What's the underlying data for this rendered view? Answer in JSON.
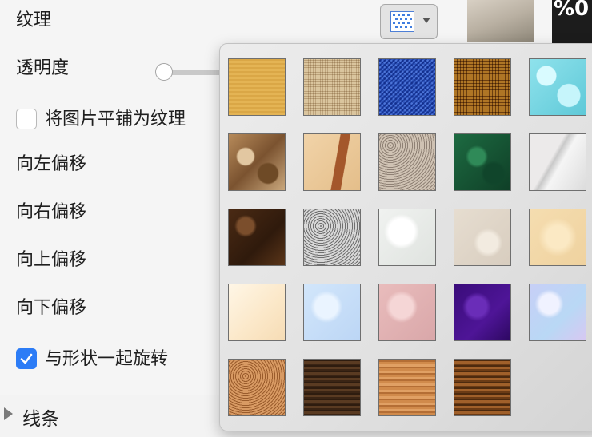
{
  "format_panel": {
    "texture_label": "纹理",
    "transparency_label": "透明度",
    "transparency_value": 0,
    "tile_as_texture": {
      "label": "将图片平铺为纹理",
      "checked": false
    },
    "offset_left_label": "向左偏移",
    "offset_right_label": "向右偏移",
    "offset_up_label": "向上偏移",
    "offset_down_label": "向下偏移",
    "rotate_with_shape": {
      "label": "与形状一起旋转",
      "checked": true
    },
    "line_section_label": "线条"
  },
  "dark_strip_text": "%0",
  "texture_dropdown": {
    "icon": "texture-swatch-icon",
    "textures": [
      {
        "name": "papyrus-texture"
      },
      {
        "name": "canvas-texture"
      },
      {
        "name": "denim-texture"
      },
      {
        "name": "woven-mat-texture"
      },
      {
        "name": "water-droplets-texture"
      },
      {
        "name": "paper-bag-texture"
      },
      {
        "name": "fish-fossil-texture"
      },
      {
        "name": "brown-granite-texture"
      },
      {
        "name": "green-marble-texture"
      },
      {
        "name": "white-marble-texture"
      },
      {
        "name": "brown-marble-texture"
      },
      {
        "name": "granite-texture"
      },
      {
        "name": "newsprint-texture"
      },
      {
        "name": "sand-texture"
      },
      {
        "name": "parchment-texture"
      },
      {
        "name": "stationery-texture"
      },
      {
        "name": "blue-tissue-texture"
      },
      {
        "name": "pink-tissue-texture"
      },
      {
        "name": "purple-mesh-texture"
      },
      {
        "name": "bouquet-texture"
      },
      {
        "name": "cork-texture"
      },
      {
        "name": "walnut-texture"
      },
      {
        "name": "oak-texture"
      },
      {
        "name": "medium-wood-texture"
      }
    ]
  }
}
